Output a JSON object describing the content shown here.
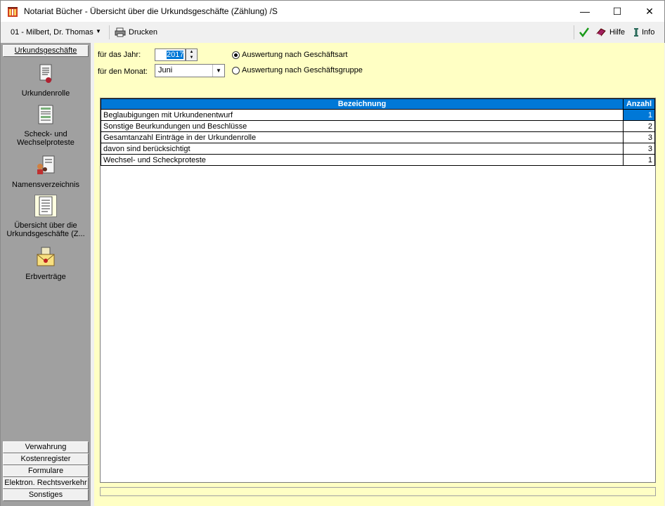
{
  "window": {
    "title": "Notariat Bücher - Übersicht über die Urkundsgeschäfte (Zählung) /S",
    "minimize": "—",
    "maximize": "☐",
    "close": "✕"
  },
  "toolbar": {
    "user": "01 - Milbert, Dr. Thomas",
    "print_label": "Drucken",
    "help_label": "Hilfe",
    "info_label": "Info"
  },
  "sidebar": {
    "header": "Urkundsgeschäfte",
    "items": [
      {
        "label": "Urkundenrolle"
      },
      {
        "label": "Scheck- und Wechselproteste"
      },
      {
        "label": "Namensverzeichnis"
      },
      {
        "label": "Übersicht über die Urkundsgeschäfte (Z..."
      },
      {
        "label": "Erbverträge"
      }
    ],
    "bottom_buttons": [
      "Verwahrung",
      "Kostenregister",
      "Formulare",
      "Elektron. Rechtsverkehr",
      "Sonstiges"
    ]
  },
  "filter": {
    "year_label": "für das Jahr:",
    "year_value": "2017",
    "month_label": "für den Monat:",
    "month_value": "Juni",
    "radio_type": "Auswertung nach Geschäftsart",
    "radio_group": "Auswertung nach Geschäftsgruppe",
    "selected_radio": "type"
  },
  "table": {
    "headers": [
      "Bezeichnung",
      "Anzahl"
    ],
    "rows": [
      {
        "name": "Beglaubigungen mit Urkundenentwurf",
        "count": "1"
      },
      {
        "name": "Sonstige Beurkundungen und Beschlüsse",
        "count": "2"
      },
      {
        "name": "Gesamtanzahl Einträge in der Urkundenrolle",
        "count": "3"
      },
      {
        "name": "davon sind berücksichtigt",
        "count": "3"
      },
      {
        "name": "Wechsel- und Scheckproteste",
        "count": "1"
      }
    ]
  },
  "colors": {
    "accent": "#0078d7",
    "main_bg": "#ffffc4",
    "sidebar_bg": "#a0a0a0"
  }
}
